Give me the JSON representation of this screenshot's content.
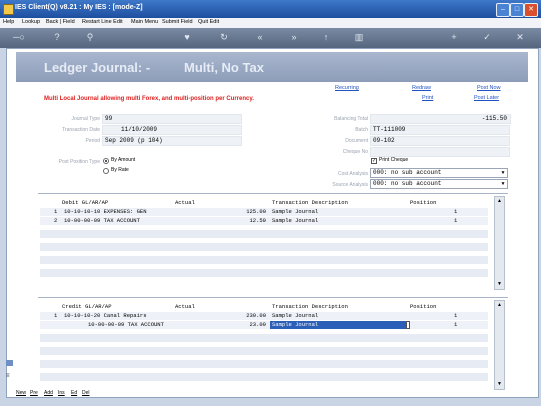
{
  "window": {
    "title": "IES Client(Q) v8.21 : My IES :     [mode-Z]",
    "buttons": {
      "minimize": "–",
      "maximize": "□",
      "close": "✕"
    }
  },
  "menu": [
    "Help",
    "Lookup",
    "Back | Field",
    "Restart Line Edit",
    "Main Menu",
    "Submit Field",
    "Quit Edit"
  ],
  "toolbar": {
    "icons": [
      "key-icon",
      "help-icon",
      "search-icon",
      "heart-icon",
      "refresh-icon",
      "rewind-icon",
      "fast-forward-icon",
      "upload-icon",
      "trash-icon",
      "add-icon",
      "check-icon",
      "close-icon"
    ]
  },
  "banner": {
    "title": "Ledger Journal: -",
    "subtitle": "Multi, No Tax"
  },
  "links": {
    "recurring": "Recurring",
    "redraw": "Redraw",
    "print": "Print",
    "post_now": "Post Now",
    "post_later": "Post Later"
  },
  "warning": "Multi Local Journal allowing multi Forex, and multi-position per Currency.",
  "form": {
    "journal_type": {
      "label": "Journal Type",
      "value": "99"
    },
    "transaction_date": {
      "label": "Transaction Date",
      "value": "11/10/2009"
    },
    "period": {
      "label": "Period",
      "value": "Sep 2009 (p 104)"
    },
    "post_position_type": {
      "label": "Post Position Type",
      "options": [
        "By Amount",
        "By Rate"
      ],
      "selected": "By Amount"
    },
    "balancing_total": {
      "label": "Balancing Total",
      "value": "-115.50"
    },
    "batch": {
      "label": "Batch",
      "value": "TT-111009"
    },
    "document": {
      "label": "Document",
      "value": "09-102"
    },
    "cheque_no": {
      "label": "Cheque No",
      "value": ""
    },
    "print_cheque": {
      "label": "Print Cheque",
      "checked": true
    },
    "cost_analysis": {
      "label": "Cost Analysis",
      "value": "000: no sub account"
    },
    "source_analysis": {
      "label": "Source Analysis",
      "value": "000: no sub account"
    }
  },
  "debit_grid": {
    "headers": [
      "Debit GL/AR/AP",
      "Actual",
      "Transaction Description",
      "Position"
    ],
    "rows": [
      {
        "num": "1",
        "account": "10-10-10-10 EXPENSES: GEN",
        "actual": "125.00",
        "description": "Sample Journal",
        "position": "1"
      },
      {
        "num": "2",
        "account": "10-00-00-09 TAX ACCOUNT",
        "actual": "12.50",
        "description": "Sample Journal",
        "position": "1"
      }
    ]
  },
  "credit_grid": {
    "headers": [
      "Credit GL/AR/AP",
      "Actual",
      "Transaction Description",
      "Position"
    ],
    "rows": [
      {
        "num": "1",
        "account": "10-10-10-20 Canal Repairs",
        "actual": "230.00",
        "description": "Sample Journal",
        "position": "1"
      },
      {
        "num": "",
        "account": "10-00-00-09 TAX ACCOUNT",
        "actual": "23.00",
        "description": "Sample Journal",
        "position": "1"
      }
    ]
  },
  "bottom_links": [
    "New",
    "Pre",
    "Add",
    "Ins",
    "Ed",
    "Del"
  ],
  "colors": {
    "banner": "#8d9db9",
    "warning": "#e02020",
    "link": "#2052c2",
    "selected_cell": "#2c5fb8"
  }
}
